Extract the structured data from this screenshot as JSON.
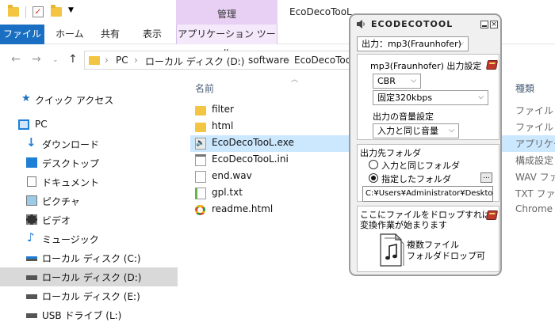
{
  "explorer": {
    "window_title": "EcoDecoTooL",
    "context_tab_group": "管理",
    "ribbon_tabs": [
      "ファイル",
      "ホーム",
      "共有",
      "表示",
      "アプリケーション ツール"
    ],
    "breadcrumb": [
      "PC",
      "ローカル ディスク (D:)",
      "software",
      "EcoDecoTooL"
    ],
    "columns": {
      "name": "名前",
      "type": "種類"
    },
    "nav_items": [
      {
        "label": "クイック アクセス",
        "icon": "star-icon"
      },
      {
        "label": "PC",
        "icon": "computer-icon"
      },
      {
        "label": "ダウンロード",
        "icon": "download-icon"
      },
      {
        "label": "デスクトップ",
        "icon": "desktop-icon"
      },
      {
        "label": "ドキュメント",
        "icon": "document-icon"
      },
      {
        "label": "ピクチャ",
        "icon": "picture-icon"
      },
      {
        "label": "ビデオ",
        "icon": "video-icon"
      },
      {
        "label": "ミュージック",
        "icon": "music-icon"
      },
      {
        "label": "ローカル ディスク (C:)",
        "icon": "drive-icon"
      },
      {
        "label": "ローカル ディスク (D:)",
        "icon": "drive-icon",
        "selected": true
      },
      {
        "label": "ローカル ディスク (E:)",
        "icon": "drive-icon"
      },
      {
        "label": "USB ドライブ (L:)",
        "icon": "usb-drive-icon"
      }
    ],
    "files": [
      {
        "name": "filter",
        "type": "ファイル フォ",
        "icon": "folder-icon"
      },
      {
        "name": "html",
        "type": "ファイル フォ",
        "icon": "folder-icon"
      },
      {
        "name": "EcoDecoTooL.exe",
        "type": "アプリケーシ",
        "icon": "exe-icon",
        "selected": true
      },
      {
        "name": "EcoDecoTooL.ini",
        "type": "構成設定",
        "icon": "ini-icon"
      },
      {
        "name": "end.wav",
        "type": "WAV ファイル",
        "icon": "wav-icon"
      },
      {
        "name": "gpl.txt",
        "type": "TXT ファイル",
        "icon": "txt-icon"
      },
      {
        "name": "readme.html",
        "type": "Chrome H",
        "icon": "chrome-icon"
      }
    ]
  },
  "eco": {
    "title": "ECODECOTOOL",
    "output_select": "出力：mp3(Fraunhofer)",
    "mp3_settings_label": "mp3(Fraunhofer) 出力設定",
    "bitrate_mode": "CBR",
    "bitrate": "固定320kbps",
    "volume_label": "出力の音量設定",
    "volume_select": "入力と同じ音量",
    "output_folder_label": "出力先フォルダ",
    "radio_same": "入力と同じフォルダ",
    "radio_specified": "指定したフォルダ",
    "browse_label": "...",
    "output_path": "C:¥Users¥Administrator¥Desktop",
    "drop_hint_line1": "ここにファイルをドロップすれば",
    "drop_hint_line2": "変換作業が始まります",
    "multi_line1": "複数ファイル",
    "multi_line2": "フォルダドロップ可"
  }
}
